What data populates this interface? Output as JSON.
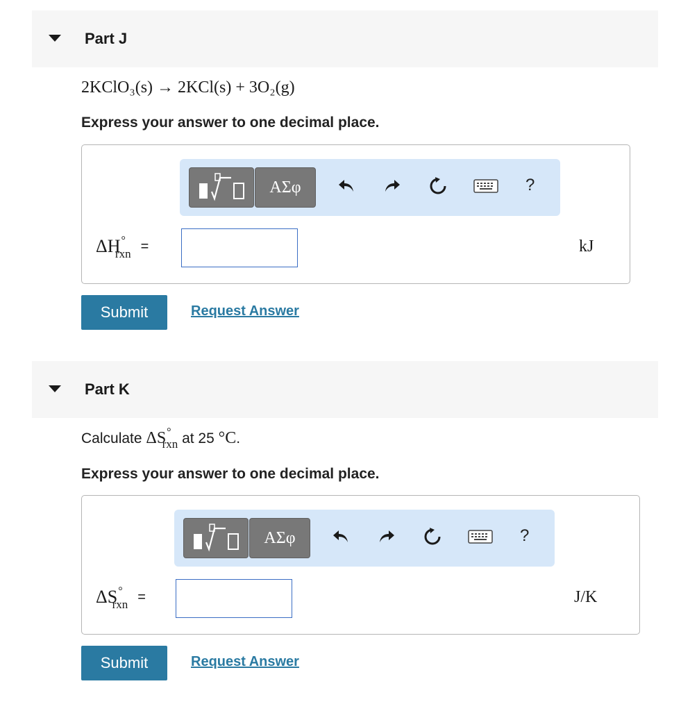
{
  "parts": [
    {
      "title": "Part J",
      "question": "2KClO₃(s) → 2KCl(s) + 3O₂(g)",
      "instruction": "Express your answer to one decimal place.",
      "toolbar": {
        "greek_label": "ΑΣφ",
        "help_label": "?"
      },
      "label_main": "ΔH",
      "label_sup": "°",
      "label_sub": "rxn",
      "label_eq": "=",
      "input_value": "",
      "unit": "kJ",
      "submit_label": "Submit",
      "request_label": "Request Answer"
    },
    {
      "title": "Part K",
      "question_prefix": "Calculate ",
      "question_math_main": "ΔS",
      "question_math_sup": "°",
      "question_math_sub": "rxn",
      "question_mid": " at 25 ",
      "question_temp": "°C",
      "question_end": ".",
      "instruction": "Express your answer to one decimal place.",
      "toolbar": {
        "greek_label": "ΑΣφ",
        "help_label": "?"
      },
      "label_main": "ΔS",
      "label_sup": "°",
      "label_sub": "rxn",
      "label_eq": "=",
      "input_value": "",
      "unit": "J/K",
      "submit_label": "Submit",
      "request_label": "Request Answer"
    }
  ],
  "colors": {
    "accent": "#2a7aa2",
    "toolbar_bg": "#d6e7f9",
    "header_bg": "#f6f6f6",
    "input_border": "#3a6dc4"
  }
}
